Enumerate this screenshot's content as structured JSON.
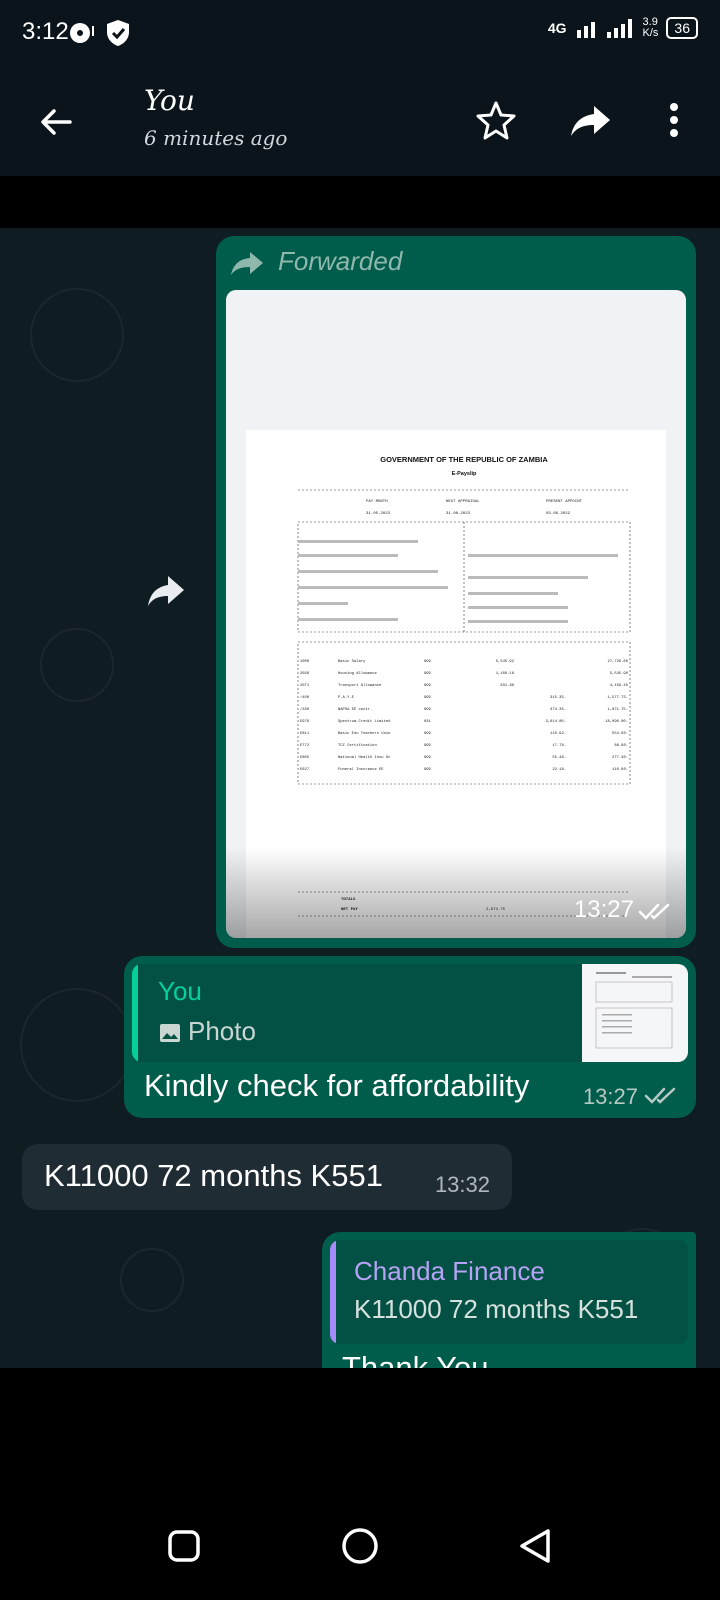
{
  "status_bar": {
    "time": "3:12",
    "network": "4G",
    "speed": "3.9\nK/s",
    "battery": "36"
  },
  "header": {
    "title": "You",
    "subtitle": "6 minutes ago"
  },
  "image_message": {
    "forwarded_label": "Forwarded",
    "time": "13:27",
    "document": {
      "heading": "GOVERNMENT OF THE REPUBLIC OF ZAMBIA",
      "subheading": "E-Payslip",
      "pay_month_label": "PAY MONTH",
      "pay_month": "31.05.2023",
      "next_appraisal_label": "NEXT APPRAISAL",
      "next_appraisal": "31.08.2023",
      "present_appoint_label": "PRESENT APPOINT",
      "present_appoint": "03.08.2022",
      "rows": [
        [
          "1000",
          "Basic Salary",
          "999",
          "5,545.92",
          "",
          "27,729.60"
        ],
        [
          "2026",
          "Housing Allowance",
          "999",
          "1,109.18",
          "",
          "5,545.90"
        ],
        [
          "2071",
          "Transport Allowance",
          "999",
          "831.89",
          "",
          "4,159.45"
        ],
        [
          "/400",
          "P.A.Y.E",
          "999",
          "",
          "315.35-",
          "1,577.73-"
        ],
        [
          "/330",
          "NAPSA EE contr.",
          "999",
          "",
          "374.35-",
          "1,871.75-"
        ],
        [
          "E976",
          "Spectrum Credit Limited",
          "031",
          "",
          "3,614.00-",
          "18,090.00-"
        ],
        [
          "E811",
          "Basic Edu Teachers Unio",
          "999",
          "",
          "110.92-",
          "554.60-"
        ],
        [
          "E772",
          "TCZ Certification",
          "999",
          "",
          "17.78-",
          "88.90-"
        ],
        [
          "E805",
          "National Health Insu Sc",
          "999",
          "",
          "55.46-",
          "277.30-"
        ],
        [
          "E627",
          "Funeral Insurance EE",
          "999",
          "",
          "22.18-",
          "110.90-"
        ]
      ],
      "totals_label": "TOTALS",
      "net_pay_label": "NET PAY",
      "net_pay": "2,972.75"
    }
  },
  "reply_message": {
    "quoted_name": "You",
    "quoted_type": "Photo",
    "text": "Kindly check for affordability",
    "time": "13:27"
  },
  "incoming_message": {
    "text": "K11000 72 months K551",
    "time": "13:32"
  },
  "outgoing_message_2": {
    "quoted_name": "Chanda Finance",
    "quoted_text": "K11000 72 months K551",
    "text": "Thank You"
  },
  "colors": {
    "outgoing_bubble": "#005c4b",
    "incoming_bubble": "#202c33",
    "accent": "#06cf9c"
  }
}
